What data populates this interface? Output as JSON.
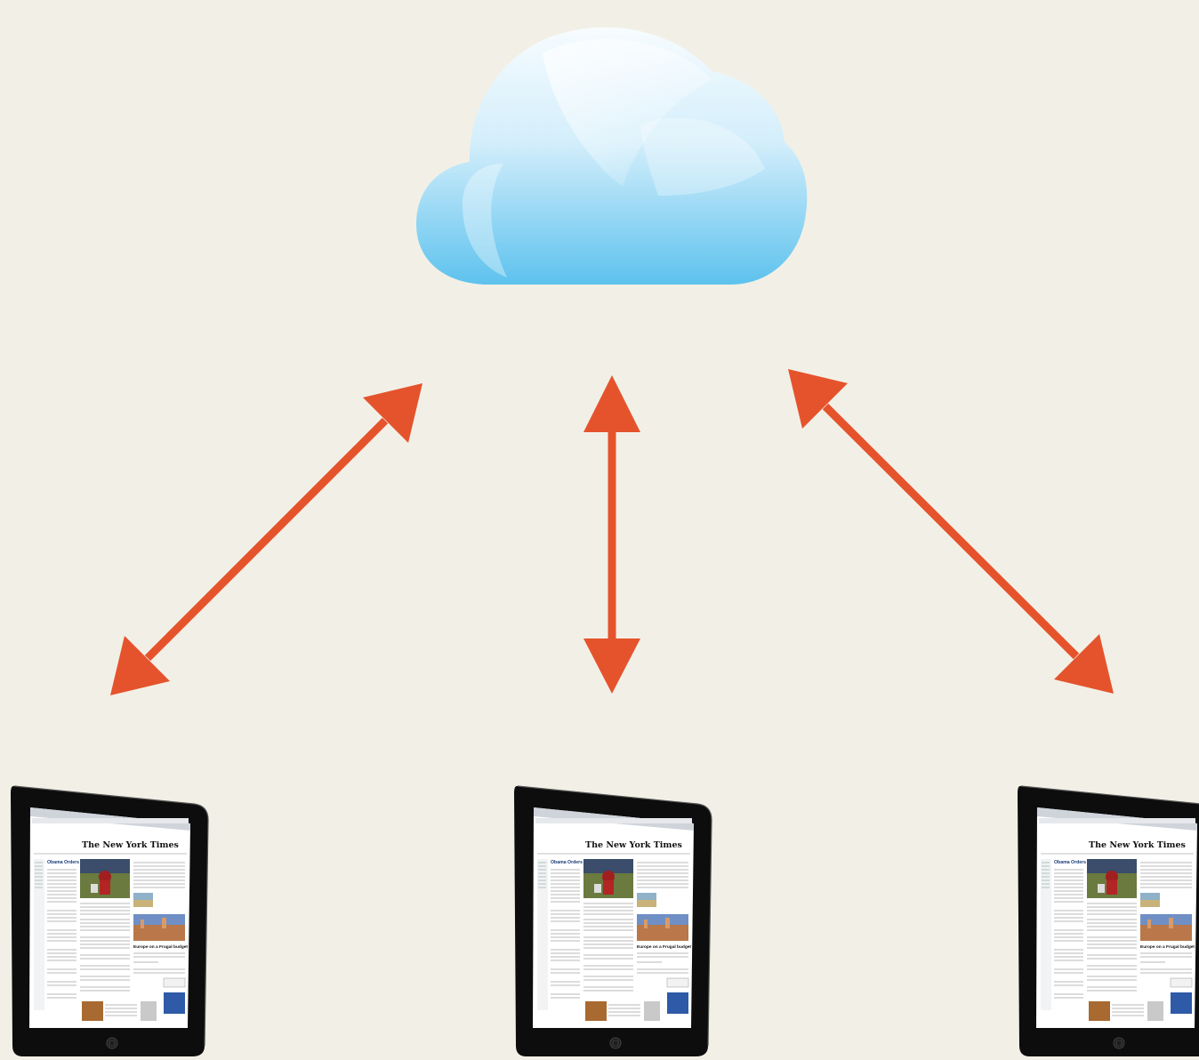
{
  "colors": {
    "background": "#f2f0e6",
    "arrow": "#e5532d",
    "cloud_top": "#f4fbff",
    "cloud_bottom": "#5fc3ee",
    "tablet_bezel": "#0d0d0d"
  },
  "icons": [
    "cloud-icon",
    "double-arrow-icon",
    "tablet-icon"
  ],
  "cloud": {
    "label": ""
  },
  "tablets": [
    {
      "name": "tablet-left",
      "masthead": "The New York Times",
      "headline_1": "Obama Orders Improvements in Security Policies",
      "headline_2": "Europe on a Frugal budget"
    },
    {
      "name": "tablet-center",
      "masthead": "The New York Times",
      "headline_1": "Obama Orders Improvements in Security Policies",
      "headline_2": "Europe on a Frugal budget"
    },
    {
      "name": "tablet-right",
      "masthead": "The New York Times",
      "headline_1": "Obama Orders Improvements in Security Policies",
      "headline_2": "Europe on a Frugal budget"
    }
  ]
}
